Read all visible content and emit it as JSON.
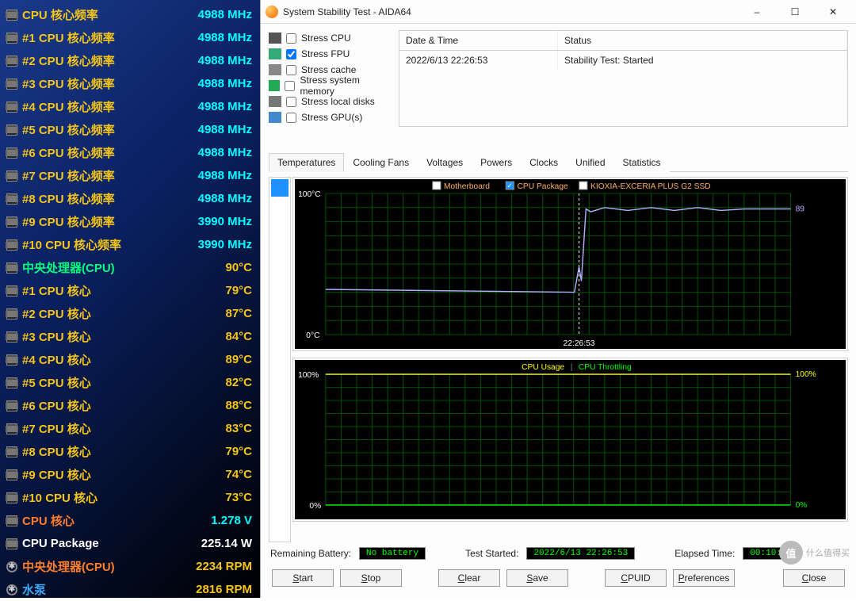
{
  "sidebar": {
    "rows": [
      {
        "icon": "chip",
        "label": "CPU 核心频率",
        "value": "4988 MHz",
        "lc": "c-yellow",
        "vc": "c-cyan"
      },
      {
        "icon": "chip",
        "label": "#1 CPU 核心频率",
        "value": "4988 MHz",
        "lc": "c-yellow",
        "vc": "c-cyan"
      },
      {
        "icon": "chip",
        "label": "#2 CPU 核心频率",
        "value": "4988 MHz",
        "lc": "c-yellow",
        "vc": "c-cyan"
      },
      {
        "icon": "chip",
        "label": "#3 CPU 核心频率",
        "value": "4988 MHz",
        "lc": "c-yellow",
        "vc": "c-cyan"
      },
      {
        "icon": "chip",
        "label": "#4 CPU 核心频率",
        "value": "4988 MHz",
        "lc": "c-yellow",
        "vc": "c-cyan"
      },
      {
        "icon": "chip",
        "label": "#5 CPU 核心频率",
        "value": "4988 MHz",
        "lc": "c-yellow",
        "vc": "c-cyan"
      },
      {
        "icon": "chip",
        "label": "#6 CPU 核心频率",
        "value": "4988 MHz",
        "lc": "c-yellow",
        "vc": "c-cyan"
      },
      {
        "icon": "chip",
        "label": "#7 CPU 核心频率",
        "value": "4988 MHz",
        "lc": "c-yellow",
        "vc": "c-cyan"
      },
      {
        "icon": "chip",
        "label": "#8 CPU 核心频率",
        "value": "4988 MHz",
        "lc": "c-yellow",
        "vc": "c-cyan"
      },
      {
        "icon": "chip",
        "label": "#9 CPU 核心频率",
        "value": "3990 MHz",
        "lc": "c-yellow",
        "vc": "c-cyan"
      },
      {
        "icon": "chip",
        "label": "#10 CPU 核心频率",
        "value": "3990 MHz",
        "lc": "c-yellow",
        "vc": "c-cyan"
      },
      {
        "icon": "chip",
        "label": "中央处理器(CPU)",
        "value": "90°C",
        "lc": "c-green",
        "vc": "c-yellow"
      },
      {
        "icon": "chip",
        "label": "#1 CPU 核心",
        "value": "79°C",
        "lc": "c-yellow",
        "vc": "c-yellow"
      },
      {
        "icon": "chip",
        "label": "#2 CPU 核心",
        "value": "87°C",
        "lc": "c-yellow",
        "vc": "c-yellow"
      },
      {
        "icon": "chip",
        "label": "#3 CPU 核心",
        "value": "84°C",
        "lc": "c-yellow",
        "vc": "c-yellow"
      },
      {
        "icon": "chip",
        "label": "#4 CPU 核心",
        "value": "89°C",
        "lc": "c-yellow",
        "vc": "c-yellow"
      },
      {
        "icon": "chip",
        "label": "#5 CPU 核心",
        "value": "82°C",
        "lc": "c-yellow",
        "vc": "c-yellow"
      },
      {
        "icon": "chip",
        "label": "#6 CPU 核心",
        "value": "88°C",
        "lc": "c-yellow",
        "vc": "c-yellow"
      },
      {
        "icon": "chip",
        "label": "#7 CPU 核心",
        "value": "83°C",
        "lc": "c-yellow",
        "vc": "c-yellow"
      },
      {
        "icon": "chip",
        "label": "#8 CPU 核心",
        "value": "79°C",
        "lc": "c-yellow",
        "vc": "c-yellow"
      },
      {
        "icon": "chip",
        "label": "#9 CPU 核心",
        "value": "74°C",
        "lc": "c-yellow",
        "vc": "c-yellow"
      },
      {
        "icon": "chip",
        "label": "#10 CPU 核心",
        "value": "73°C",
        "lc": "c-yellow",
        "vc": "c-yellow"
      },
      {
        "icon": "chip",
        "label": "CPU 核心",
        "value": "1.278 V",
        "lc": "c-orange",
        "vc": "c-cyan"
      },
      {
        "icon": "chip",
        "label": "CPU Package",
        "value": "225.14 W",
        "lc": "c-white",
        "vc": "c-white"
      },
      {
        "icon": "fan",
        "label": "中央处理器(CPU)",
        "value": "2234 RPM",
        "lc": "c-orange",
        "vc": "c-yellow"
      },
      {
        "icon": "fan",
        "label": "水泵",
        "value": "2816 RPM",
        "lc": "c-blue",
        "vc": "c-yellow"
      }
    ]
  },
  "window": {
    "title": "System Stability Test - AIDA64",
    "minimize": "–",
    "maximize": "☐",
    "close": "✕"
  },
  "checks": [
    {
      "icon": "cpu",
      "label": "Stress CPU",
      "checked": false
    },
    {
      "icon": "fpu",
      "label": "Stress FPU",
      "checked": true
    },
    {
      "icon": "cache",
      "label": "Stress cache",
      "checked": false
    },
    {
      "icon": "mem",
      "label": "Stress system memory",
      "checked": false
    },
    {
      "icon": "disk",
      "label": "Stress local disks",
      "checked": false
    },
    {
      "icon": "gpu",
      "label": "Stress GPU(s)",
      "checked": false
    }
  ],
  "status_table": {
    "headers": [
      "Date & Time",
      "Status"
    ],
    "rows": [
      [
        "2022/6/13 22:26:53",
        "Stability Test: Started"
      ]
    ]
  },
  "tabs": [
    "Temperatures",
    "Cooling Fans",
    "Voltages",
    "Powers",
    "Clocks",
    "Unified",
    "Statistics"
  ],
  "active_tab": "Temperatures",
  "legend_temp": [
    {
      "label": "Motherboard",
      "checked": false,
      "color": "#ffffff"
    },
    {
      "label": "CPU Package",
      "checked": true,
      "color": "#c0c0ff"
    },
    {
      "label": "KIOXIA-EXCERIA PLUS G2 SSD",
      "checked": false,
      "color": "#ffffff"
    }
  ],
  "legend_usage": [
    {
      "label": "CPU Usage",
      "color": "#ffff00"
    },
    {
      "label": "CPU Throttling",
      "color": "#00ff00"
    }
  ],
  "chart_data": [
    {
      "type": "line",
      "title": "Temperatures",
      "xlabel_marker": "22:26:53",
      "ylabel_top": "100°C",
      "ylabel_bot": "0°C",
      "ylim": [
        0,
        100
      ],
      "series": [
        {
          "name": "CPU Package",
          "values": [
            {
              "x": 0,
              "y": 32
            },
            {
              "x": 0.535,
              "y": 30
            },
            {
              "x": 0.545,
              "y": 48
            },
            {
              "x": 0.55,
              "y": 38
            },
            {
              "x": 0.56,
              "y": 89
            },
            {
              "x": 0.57,
              "y": 87
            },
            {
              "x": 0.6,
              "y": 90
            },
            {
              "x": 0.65,
              "y": 88
            },
            {
              "x": 0.7,
              "y": 90
            },
            {
              "x": 0.75,
              "y": 88
            },
            {
              "x": 0.8,
              "y": 90
            },
            {
              "x": 0.85,
              "y": 88
            },
            {
              "x": 0.9,
              "y": 89
            },
            {
              "x": 0.95,
              "y": 89
            },
            {
              "x": 1.0,
              "y": 89
            }
          ],
          "end_label": "89",
          "color": "#b0b0ff"
        }
      ],
      "marker_x": 0.545
    },
    {
      "type": "line",
      "title": "CPU Usage / Throttling",
      "ylabel_top": "100%",
      "ylabel_bot": "0%",
      "ylim": [
        0,
        100
      ],
      "series": [
        {
          "name": "CPU Usage",
          "values": [
            {
              "x": 0,
              "y": 100
            },
            {
              "x": 1,
              "y": 100
            }
          ],
          "end_label": "100%",
          "color": "#ffff00"
        },
        {
          "name": "CPU Throttling",
          "values": [
            {
              "x": 0,
              "y": 0
            },
            {
              "x": 1,
              "y": 0
            }
          ],
          "end_label": "0%",
          "color": "#00ff00"
        }
      ]
    }
  ],
  "status_line": {
    "battery_lbl": "Remaining Battery:",
    "battery_val": "No battery",
    "started_lbl": "Test Started:",
    "started_val": "2022/6/13 22:26:53",
    "elapsed_lbl": "Elapsed Time:",
    "elapsed_val": "00:10:48"
  },
  "buttons": [
    "Start",
    "Stop",
    "Clear",
    "Save",
    "CPUID",
    "Preferences",
    "Close"
  ],
  "watermark": "什么值得买"
}
